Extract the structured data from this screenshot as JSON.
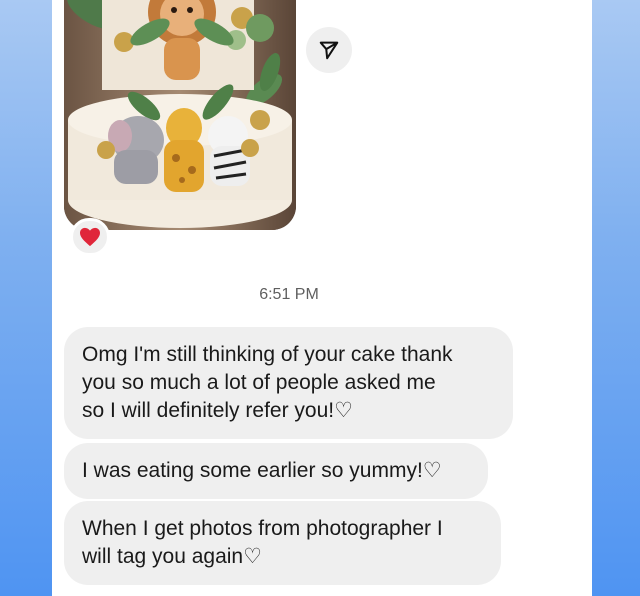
{
  "chat": {
    "timestamp": "6:51 PM",
    "messages": [
      {
        "text": "Omg I'm still thinking of your cake thank\nyou so much a lot of people asked me\nso I will definitely refer you!♡"
      },
      {
        "text": "I was eating some earlier so yummy!♡"
      },
      {
        "text": "When I get photos from photographer I\nwill tag you again♡"
      }
    ],
    "photo_message": {
      "reaction": "❤️",
      "share_icon": "send-arrow-icon"
    }
  },
  "colors": {
    "background_top": "#a9c9f3",
    "background_bottom": "#4f94f2",
    "panel": "#ffffff",
    "bubble": "#efefef",
    "reaction_heart": "#e0263a"
  }
}
